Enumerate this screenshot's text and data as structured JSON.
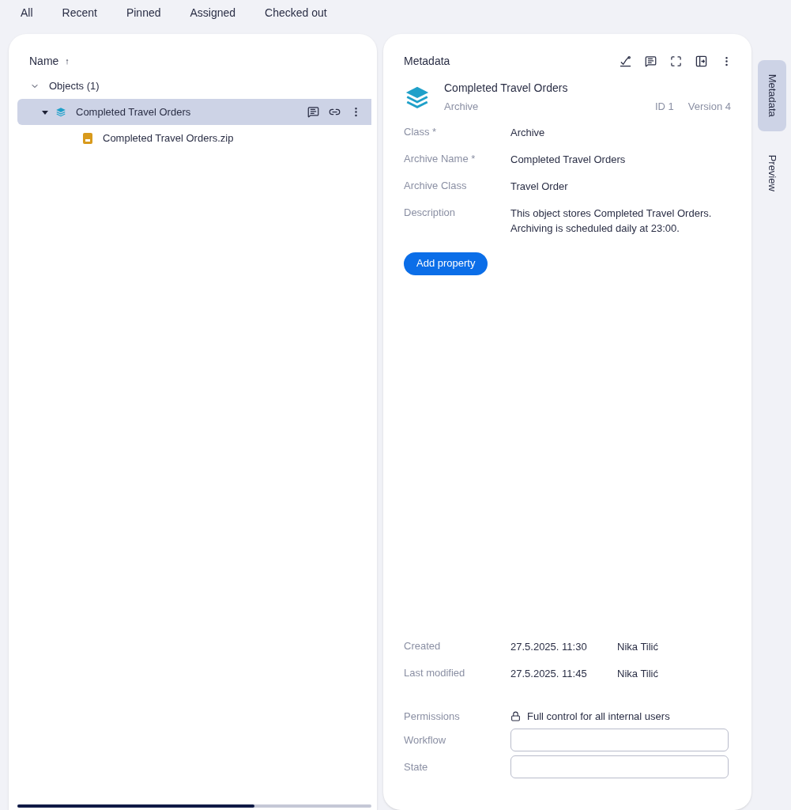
{
  "nav_tabs": [
    "All",
    "Recent",
    "Pinned",
    "Assigned",
    "Checked out"
  ],
  "list": {
    "column": "Name",
    "sort_arrow": "↑",
    "group": {
      "label": "Objects (1)",
      "expanded": true,
      "items": [
        {
          "kind": "archive",
          "label": "Completed Travel Orders",
          "selected": true,
          "expanded": true,
          "children": [
            {
              "kind": "zip",
              "label": "Completed Travel Orders.zip",
              "selected": false
            }
          ]
        }
      ]
    }
  },
  "metadata": {
    "title": "Metadata",
    "object": {
      "name": "Completed Travel Orders",
      "class": "Archive",
      "id": "ID 1",
      "version": "Version 4"
    },
    "properties": [
      {
        "label": "Class *",
        "value": "Archive"
      },
      {
        "label": "Archive Name *",
        "value": "Completed Travel Orders"
      },
      {
        "label": "Archive Class",
        "value": "Travel Order"
      },
      {
        "label": "Description",
        "value": "This object stores Completed Travel Orders. Archiving is scheduled daily at 23:00."
      }
    ],
    "add_button": "Add property",
    "history": [
      {
        "label": "Created",
        "date": "27.5.2025. 11:30",
        "user": "Nika Tilić"
      },
      {
        "label": "Last modified",
        "date": "27.5.2025. 11:45",
        "user": "Nika Tilić"
      }
    ],
    "permissions": {
      "label": "Permissions",
      "value": "Full control for all internal users"
    },
    "fields": [
      {
        "label": "Workflow"
      },
      {
        "label": "State"
      }
    ]
  },
  "side_tabs": [
    {
      "label": "Metadata",
      "selected": true
    },
    {
      "label": "Preview",
      "selected": false
    }
  ]
}
